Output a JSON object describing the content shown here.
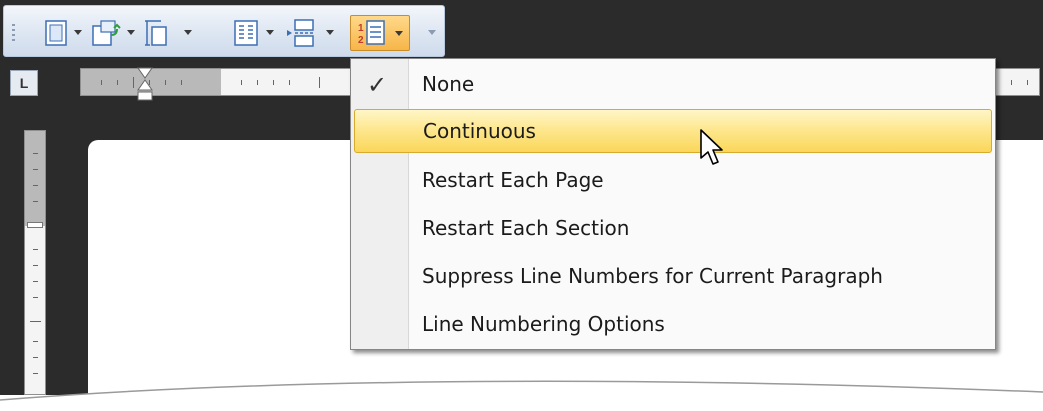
{
  "toolbar": {
    "buttons": [
      {
        "name": "margins-button",
        "icon": "margins-icon"
      },
      {
        "name": "orientation-button",
        "icon": "orientation-icon"
      },
      {
        "name": "size-button",
        "icon": "page-size-icon"
      },
      {
        "name": "columns-button",
        "icon": "columns-icon"
      },
      {
        "name": "breaks-button",
        "icon": "breaks-icon"
      },
      {
        "name": "line-numbers-button",
        "icon": "line-numbers-icon",
        "active": true
      }
    ],
    "active_color": "#f7b548"
  },
  "ruler": {
    "corner_label": "L"
  },
  "menu": {
    "items": [
      {
        "label": "None",
        "checked": true
      },
      {
        "label": "Continuous",
        "highlighted": true
      },
      {
        "label": "Restart Each Page"
      },
      {
        "label": "Restart Each Section"
      },
      {
        "label": "Suppress Line Numbers for Current Paragraph"
      },
      {
        "label": "Line Numbering Options"
      }
    ],
    "check_glyph": "✓"
  },
  "colors": {
    "highlight": "#fde68a",
    "workspace": "#2b2b2b"
  }
}
